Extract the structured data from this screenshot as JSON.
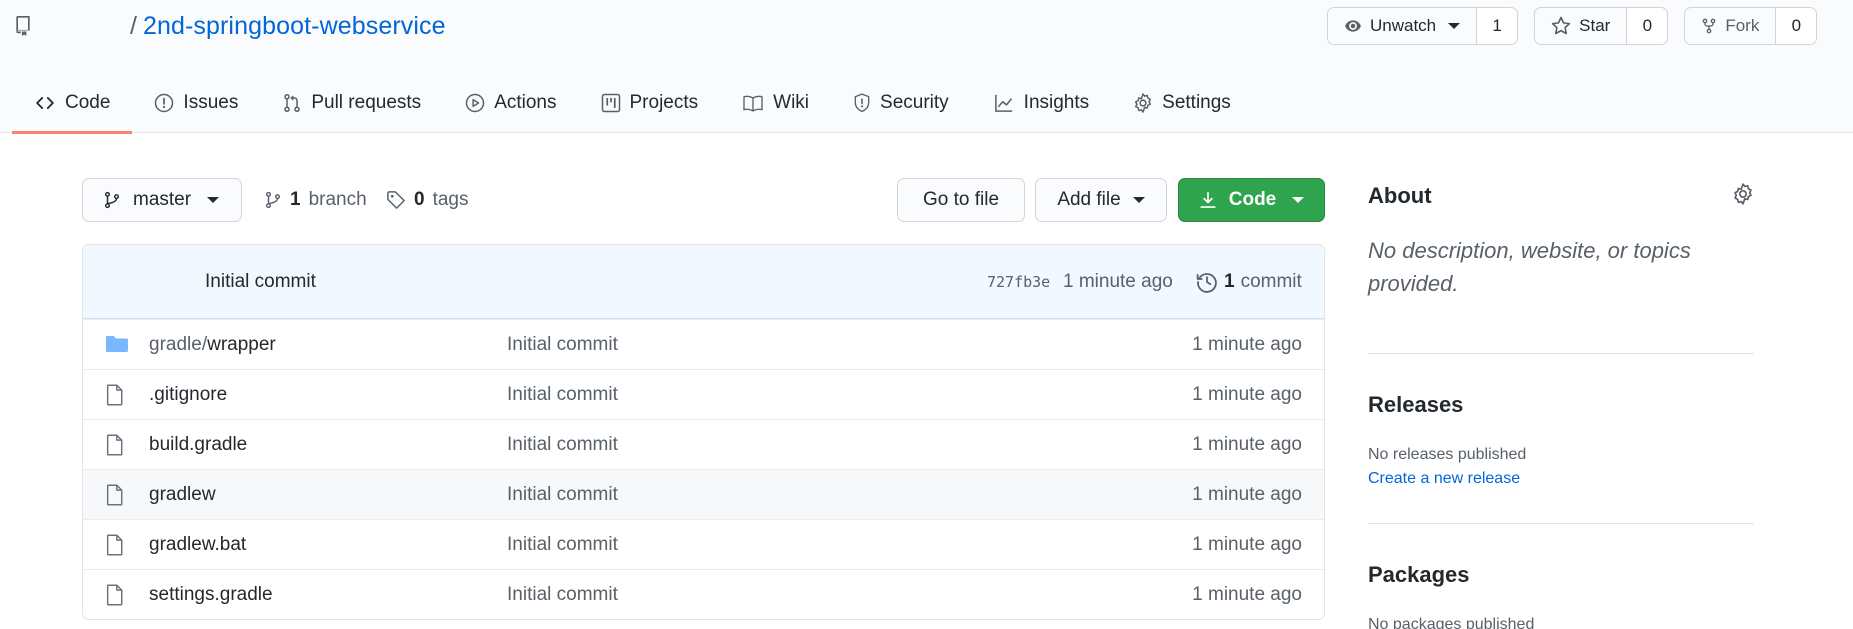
{
  "repo": {
    "name": "2nd-springboot-webservice",
    "separator": "/"
  },
  "header_actions": {
    "watch": {
      "label": "Unwatch",
      "count": "1"
    },
    "star": {
      "label": "Star",
      "count": "0"
    },
    "fork": {
      "label": "Fork",
      "count": "0"
    }
  },
  "tabs": [
    {
      "label": "Code",
      "icon": "code-icon"
    },
    {
      "label": "Issues",
      "icon": "issue-icon"
    },
    {
      "label": "Pull requests",
      "icon": "pull-request-icon"
    },
    {
      "label": "Actions",
      "icon": "play-icon"
    },
    {
      "label": "Projects",
      "icon": "project-icon"
    },
    {
      "label": "Wiki",
      "icon": "book-icon"
    },
    {
      "label": "Security",
      "icon": "shield-icon"
    },
    {
      "label": "Insights",
      "icon": "graph-icon"
    },
    {
      "label": "Settings",
      "icon": "gear-icon"
    }
  ],
  "toolbar": {
    "branch": "master",
    "branch_count": "1",
    "branch_label": "branch",
    "tag_count": "0",
    "tag_label": "tags",
    "go_to_file": "Go to file",
    "add_file": "Add file",
    "code": "Code"
  },
  "latest_commit": {
    "message": "Initial commit",
    "sha": "727fb3e",
    "time": "1 minute ago",
    "commit_count": "1",
    "commit_label": "commit"
  },
  "files": [
    {
      "type": "dir",
      "dir": "gradle/",
      "name": "wrapper",
      "message": "Initial commit",
      "age": "1 minute ago"
    },
    {
      "type": "file",
      "name": ".gitignore",
      "message": "Initial commit",
      "age": "1 minute ago"
    },
    {
      "type": "file",
      "name": "build.gradle",
      "message": "Initial commit",
      "age": "1 minute ago"
    },
    {
      "type": "file",
      "name": "gradlew",
      "message": "Initial commit",
      "age": "1 minute ago"
    },
    {
      "type": "file",
      "name": "gradlew.bat",
      "message": "Initial commit",
      "age": "1 minute ago"
    },
    {
      "type": "file",
      "name": "settings.gradle",
      "message": "Initial commit",
      "age": "1 minute ago"
    }
  ],
  "sidebar": {
    "about_title": "About",
    "about_desc": "No description, website, or topics provided.",
    "releases_title": "Releases",
    "releases_none": "No releases published",
    "releases_link": "Create a new release",
    "packages_title": "Packages",
    "packages_none": "No packages published"
  },
  "colors": {
    "link": "#0366d6",
    "primary_button": "#2ea44f",
    "active_tab_underline": "#f9826c",
    "folder": "#79b8ff"
  }
}
